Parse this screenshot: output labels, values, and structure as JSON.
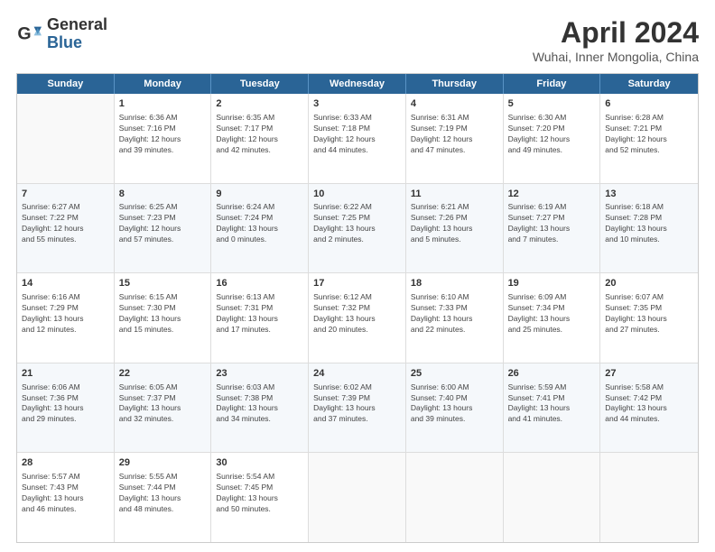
{
  "logo": {
    "general": "General",
    "blue": "Blue"
  },
  "title": {
    "month": "April 2024",
    "location": "Wuhai, Inner Mongolia, China"
  },
  "weekdays": [
    "Sunday",
    "Monday",
    "Tuesday",
    "Wednesday",
    "Thursday",
    "Friday",
    "Saturday"
  ],
  "rows": [
    [
      {
        "day": "",
        "lines": []
      },
      {
        "day": "1",
        "lines": [
          "Sunrise: 6:36 AM",
          "Sunset: 7:16 PM",
          "Daylight: 12 hours",
          "and 39 minutes."
        ]
      },
      {
        "day": "2",
        "lines": [
          "Sunrise: 6:35 AM",
          "Sunset: 7:17 PM",
          "Daylight: 12 hours",
          "and 42 minutes."
        ]
      },
      {
        "day": "3",
        "lines": [
          "Sunrise: 6:33 AM",
          "Sunset: 7:18 PM",
          "Daylight: 12 hours",
          "and 44 minutes."
        ]
      },
      {
        "day": "4",
        "lines": [
          "Sunrise: 6:31 AM",
          "Sunset: 7:19 PM",
          "Daylight: 12 hours",
          "and 47 minutes."
        ]
      },
      {
        "day": "5",
        "lines": [
          "Sunrise: 6:30 AM",
          "Sunset: 7:20 PM",
          "Daylight: 12 hours",
          "and 49 minutes."
        ]
      },
      {
        "day": "6",
        "lines": [
          "Sunrise: 6:28 AM",
          "Sunset: 7:21 PM",
          "Daylight: 12 hours",
          "and 52 minutes."
        ]
      }
    ],
    [
      {
        "day": "7",
        "lines": [
          "Sunrise: 6:27 AM",
          "Sunset: 7:22 PM",
          "Daylight: 12 hours",
          "and 55 minutes."
        ]
      },
      {
        "day": "8",
        "lines": [
          "Sunrise: 6:25 AM",
          "Sunset: 7:23 PM",
          "Daylight: 12 hours",
          "and 57 minutes."
        ]
      },
      {
        "day": "9",
        "lines": [
          "Sunrise: 6:24 AM",
          "Sunset: 7:24 PM",
          "Daylight: 13 hours",
          "and 0 minutes."
        ]
      },
      {
        "day": "10",
        "lines": [
          "Sunrise: 6:22 AM",
          "Sunset: 7:25 PM",
          "Daylight: 13 hours",
          "and 2 minutes."
        ]
      },
      {
        "day": "11",
        "lines": [
          "Sunrise: 6:21 AM",
          "Sunset: 7:26 PM",
          "Daylight: 13 hours",
          "and 5 minutes."
        ]
      },
      {
        "day": "12",
        "lines": [
          "Sunrise: 6:19 AM",
          "Sunset: 7:27 PM",
          "Daylight: 13 hours",
          "and 7 minutes."
        ]
      },
      {
        "day": "13",
        "lines": [
          "Sunrise: 6:18 AM",
          "Sunset: 7:28 PM",
          "Daylight: 13 hours",
          "and 10 minutes."
        ]
      }
    ],
    [
      {
        "day": "14",
        "lines": [
          "Sunrise: 6:16 AM",
          "Sunset: 7:29 PM",
          "Daylight: 13 hours",
          "and 12 minutes."
        ]
      },
      {
        "day": "15",
        "lines": [
          "Sunrise: 6:15 AM",
          "Sunset: 7:30 PM",
          "Daylight: 13 hours",
          "and 15 minutes."
        ]
      },
      {
        "day": "16",
        "lines": [
          "Sunrise: 6:13 AM",
          "Sunset: 7:31 PM",
          "Daylight: 13 hours",
          "and 17 minutes."
        ]
      },
      {
        "day": "17",
        "lines": [
          "Sunrise: 6:12 AM",
          "Sunset: 7:32 PM",
          "Daylight: 13 hours",
          "and 20 minutes."
        ]
      },
      {
        "day": "18",
        "lines": [
          "Sunrise: 6:10 AM",
          "Sunset: 7:33 PM",
          "Daylight: 13 hours",
          "and 22 minutes."
        ]
      },
      {
        "day": "19",
        "lines": [
          "Sunrise: 6:09 AM",
          "Sunset: 7:34 PM",
          "Daylight: 13 hours",
          "and 25 minutes."
        ]
      },
      {
        "day": "20",
        "lines": [
          "Sunrise: 6:07 AM",
          "Sunset: 7:35 PM",
          "Daylight: 13 hours",
          "and 27 minutes."
        ]
      }
    ],
    [
      {
        "day": "21",
        "lines": [
          "Sunrise: 6:06 AM",
          "Sunset: 7:36 PM",
          "Daylight: 13 hours",
          "and 29 minutes."
        ]
      },
      {
        "day": "22",
        "lines": [
          "Sunrise: 6:05 AM",
          "Sunset: 7:37 PM",
          "Daylight: 13 hours",
          "and 32 minutes."
        ]
      },
      {
        "day": "23",
        "lines": [
          "Sunrise: 6:03 AM",
          "Sunset: 7:38 PM",
          "Daylight: 13 hours",
          "and 34 minutes."
        ]
      },
      {
        "day": "24",
        "lines": [
          "Sunrise: 6:02 AM",
          "Sunset: 7:39 PM",
          "Daylight: 13 hours",
          "and 37 minutes."
        ]
      },
      {
        "day": "25",
        "lines": [
          "Sunrise: 6:00 AM",
          "Sunset: 7:40 PM",
          "Daylight: 13 hours",
          "and 39 minutes."
        ]
      },
      {
        "day": "26",
        "lines": [
          "Sunrise: 5:59 AM",
          "Sunset: 7:41 PM",
          "Daylight: 13 hours",
          "and 41 minutes."
        ]
      },
      {
        "day": "27",
        "lines": [
          "Sunrise: 5:58 AM",
          "Sunset: 7:42 PM",
          "Daylight: 13 hours",
          "and 44 minutes."
        ]
      }
    ],
    [
      {
        "day": "28",
        "lines": [
          "Sunrise: 5:57 AM",
          "Sunset: 7:43 PM",
          "Daylight: 13 hours",
          "and 46 minutes."
        ]
      },
      {
        "day": "29",
        "lines": [
          "Sunrise: 5:55 AM",
          "Sunset: 7:44 PM",
          "Daylight: 13 hours",
          "and 48 minutes."
        ]
      },
      {
        "day": "30",
        "lines": [
          "Sunrise: 5:54 AM",
          "Sunset: 7:45 PM",
          "Daylight: 13 hours",
          "and 50 minutes."
        ]
      },
      {
        "day": "",
        "lines": []
      },
      {
        "day": "",
        "lines": []
      },
      {
        "day": "",
        "lines": []
      },
      {
        "day": "",
        "lines": []
      }
    ]
  ]
}
